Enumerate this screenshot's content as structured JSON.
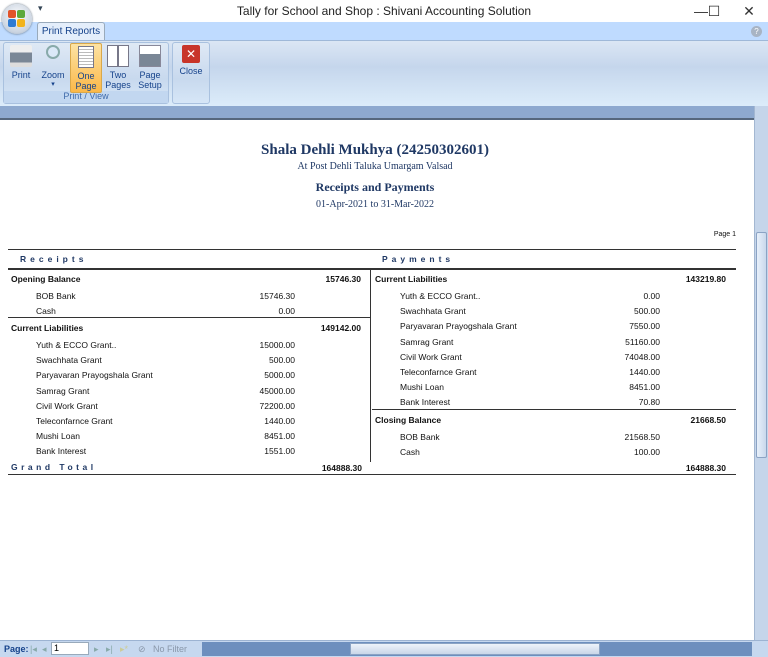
{
  "window": {
    "title": "Tally for School and Shop : Shivani Accounting Solution",
    "minimize": "—",
    "maximize": "☐",
    "close": "✕"
  },
  "ribbon": {
    "tab": "Print Reports",
    "group1_label": "Print / View",
    "buttons": {
      "print": "Print",
      "zoom": "Zoom",
      "one_page_1": "One",
      "one_page_2": "Page",
      "two_pages_1": "Two",
      "two_pages_2": "Pages",
      "page_setup_1": "Page",
      "page_setup_2": "Setup",
      "close": "Close"
    }
  },
  "report": {
    "school": "Shala Dehli Mukhya (24250302601)",
    "address": "At Post Dehli Taluka Umargam Valsad",
    "title": "Receipts and Payments",
    "period": "01-Apr-2021 to 31-Mar-2022",
    "page": "Page 1",
    "receipts_header": "Receipts",
    "payments_header": "Payments",
    "grand_total_label": "Grand Total",
    "receipts": [
      {
        "group": "Opening Balance",
        "total": "15746.30",
        "items": [
          [
            "BOB Bank",
            "15746.30"
          ],
          [
            "Cash",
            "0.00"
          ]
        ]
      },
      {
        "group": "Current Liabilities",
        "total": "149142.00",
        "items": [
          [
            "Yuth & ECCO Grant..",
            "15000.00"
          ],
          [
            "Swachhata Grant",
            "500.00"
          ],
          [
            "Paryavaran Prayogshala Grant",
            "5000.00"
          ],
          [
            "Samrag Grant",
            "45000.00"
          ],
          [
            "Civil Work Grant",
            "72200.00"
          ],
          [
            "Teleconfarnce Grant",
            "1440.00"
          ],
          [
            "Mushi Loan",
            "8451.00"
          ],
          [
            "Bank Interest",
            "1551.00"
          ]
        ]
      }
    ],
    "payments": [
      {
        "group": "Current Liabilities",
        "total": "143219.80",
        "items": [
          [
            "Yuth & ECCO Grant..",
            "0.00"
          ],
          [
            "Swachhata Grant",
            "500.00"
          ],
          [
            "Paryavaran Prayogshala Grant",
            "7550.00"
          ],
          [
            "Samrag Grant",
            "51160.00"
          ],
          [
            "Civil Work Grant",
            "74048.00"
          ],
          [
            "Teleconfarnce Grant",
            "1440.00"
          ],
          [
            "Mushi Loan",
            "8451.00"
          ],
          [
            "Bank Interest",
            "70.80"
          ]
        ]
      },
      {
        "group": "Closing Balance",
        "total": "21668.50",
        "items": [
          [
            "BOB Bank",
            "21568.50"
          ],
          [
            "Cash",
            "100.00"
          ]
        ]
      }
    ],
    "receipts_grand_total": "164888.30",
    "payments_grand_total": "164888.30"
  },
  "statusbar": {
    "page_label": "Page:",
    "page_value": "1",
    "filter": "No Filter"
  }
}
